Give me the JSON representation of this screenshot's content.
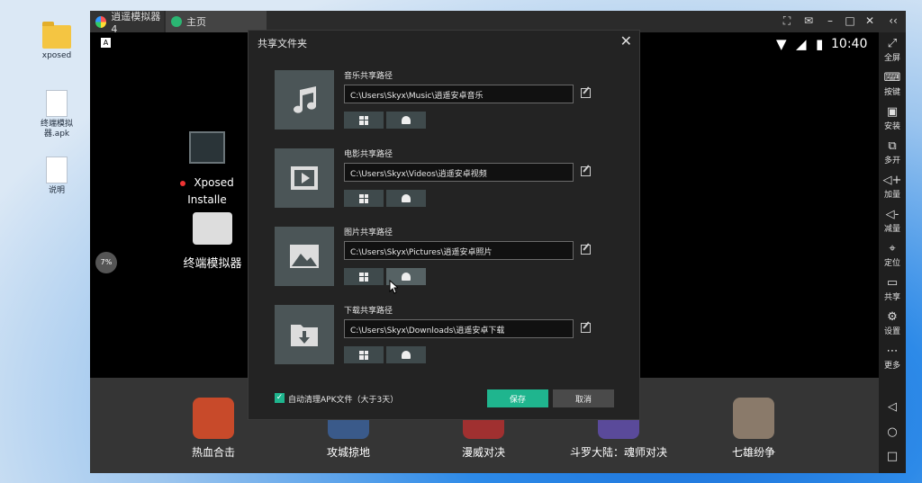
{
  "desktop": {
    "icons": [
      {
        "label": "xposed"
      },
      {
        "label": "终端模拟器.apk"
      },
      {
        "label": "说明"
      }
    ]
  },
  "window": {
    "app_tab": "逍遥模拟器4",
    "home_tab": "主页",
    "time": "10:40"
  },
  "sidebar": {
    "items": [
      {
        "label": "全屏",
        "icon": "fullscreen-icon"
      },
      {
        "label": "按键",
        "icon": "keyboard-icon"
      },
      {
        "label": "安装",
        "icon": "apk-install-icon"
      },
      {
        "label": "多开",
        "icon": "multi-instance-icon"
      },
      {
        "label": "加量",
        "icon": "volume-up-icon"
      },
      {
        "label": "减量",
        "icon": "volume-down-icon"
      },
      {
        "label": "定位",
        "icon": "location-icon"
      },
      {
        "label": "共享",
        "icon": "folder-share-icon"
      },
      {
        "label": "设置",
        "icon": "gear-icon"
      },
      {
        "label": "更多",
        "icon": "more-icon"
      }
    ]
  },
  "android": {
    "apps": [
      {
        "label": "Xposed Installe"
      },
      {
        "label": "终端模拟器"
      }
    ],
    "badge": "7%",
    "dock": [
      {
        "label": "热血合击"
      },
      {
        "label": "攻城掠地"
      },
      {
        "label": "漫威对决"
      },
      {
        "label": "斗罗大陆：魂师对决"
      },
      {
        "label": "七雄纷争"
      }
    ]
  },
  "dialog": {
    "title": "共享文件夹",
    "rows": [
      {
        "label": "音乐共享路径",
        "path": "C:\\Users\\Skyx\\Music\\逍遥安卓音乐",
        "icon": "music-note-icon"
      },
      {
        "label": "电影共享路径",
        "path": "C:\\Users\\Skyx\\Videos\\逍遥安卓视频",
        "icon": "film-icon"
      },
      {
        "label": "图片共享路径",
        "path": "C:\\Users\\Skyx\\Pictures\\逍遥安卓照片",
        "icon": "image-icon"
      },
      {
        "label": "下载共享路径",
        "path": "C:\\Users\\Skyx\\Downloads\\逍遥安卓下载",
        "icon": "download-folder-icon"
      }
    ],
    "auto_clean_label": "自动清理APK文件（大于3天）",
    "save_label": "保存",
    "cancel_label": "取消"
  },
  "colors": {
    "accent": "#1fb58e",
    "dialog_bg": "#232323",
    "thumb_bg": "#4b5557"
  }
}
